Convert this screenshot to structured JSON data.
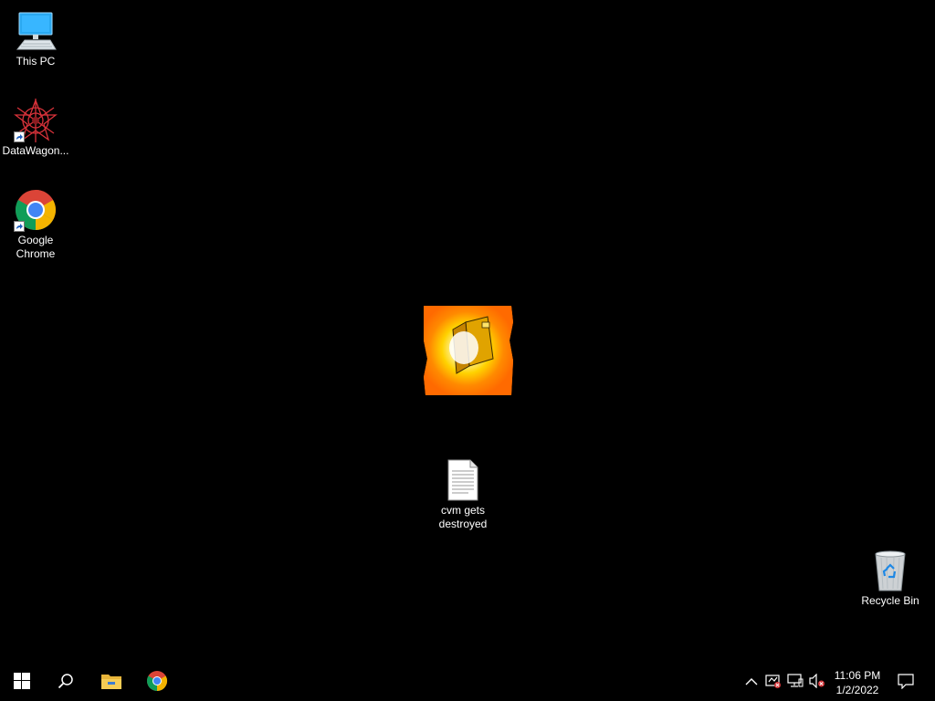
{
  "desktop": {
    "background_color": "#000000",
    "icons": [
      {
        "label": "This PC",
        "icon": "computer-icon"
      },
      {
        "label": "DataWagon...",
        "icon": "datawagon-icon"
      },
      {
        "label": "Google Chrome",
        "icon": "chrome-icon"
      },
      {
        "label": "cvm gets destroyed",
        "icon": "text-document-icon"
      },
      {
        "label": "Recycle Bin",
        "icon": "recycle-bin-icon"
      }
    ],
    "center_image": {
      "icon": "burning-server-image"
    }
  },
  "taskbar": {
    "pinned": [
      {
        "icon": "windows-start-icon"
      },
      {
        "icon": "search-icon"
      },
      {
        "icon": "file-explorer-icon"
      },
      {
        "icon": "chrome-icon"
      }
    ],
    "tray": {
      "icons": [
        "chevron-up-icon",
        "security-icon",
        "network-icon",
        "volume-muted-icon",
        "notification-icon"
      ],
      "time": "11:06 PM",
      "date": "1/2/2022"
    }
  }
}
